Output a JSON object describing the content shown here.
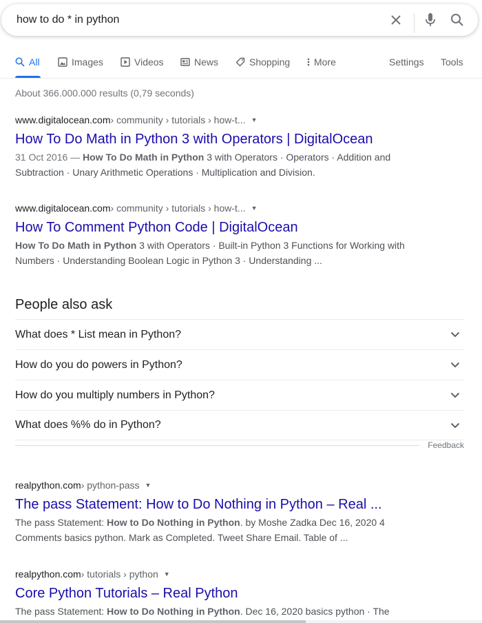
{
  "search": {
    "query": "how to do * in python",
    "clear_icon": "close-icon",
    "voice_icon": "mic-icon",
    "search_icon": "search-icon"
  },
  "tabs": [
    {
      "label": "All",
      "icon": "search-icon",
      "active": true
    },
    {
      "label": "Images",
      "icon": "image-icon"
    },
    {
      "label": "Videos",
      "icon": "play-icon"
    },
    {
      "label": "News",
      "icon": "news-icon"
    },
    {
      "label": "Shopping",
      "icon": "tag-icon"
    },
    {
      "label": "More",
      "icon": "more-vert-icon"
    }
  ],
  "tools": {
    "settings": "Settings",
    "tools": "Tools"
  },
  "stats": "About 366.000.000 results (0,79 seconds)",
  "results_top": [
    {
      "domain": "www.digitalocean.com",
      "path": " › community › tutorials › how-t...",
      "title": "How To Do Math in Python 3 with Operators | DigitalOcean",
      "date": "31 Oct 2016 — ",
      "bold": "How To Do Math in Python",
      "rest1": " 3 with Operators · Operators · Addition and",
      "rest2": "Subtraction · Unary Arithmetic Operations · Multiplication and Division."
    },
    {
      "domain": "www.digitalocean.com",
      "path": " › community › tutorials › how-t...",
      "title": "How To Comment Python Code | DigitalOcean",
      "bold": "How To Do Math in Python",
      "rest1": " 3 with Operators · Built-in Python 3 Functions for Working with",
      "rest2": "Numbers · Understanding Boolean Logic in Python 3 · Understanding ..."
    }
  ],
  "people_also_ask": {
    "title": "People also ask",
    "questions": [
      "What does * List mean in Python?",
      "How do you do powers in Python?",
      "How do you multiply numbers in Python?",
      "What does %% do in Python?"
    ],
    "feedback": "Feedback"
  },
  "results_bottom": [
    {
      "domain": "realpython.com",
      "path": " › python-pass",
      "title": "The pass Statement: How to Do Nothing in Python – Real ...",
      "pre": "The pass Statement: ",
      "bold": "How to Do Nothing in Python",
      "rest1": ". by Moshe Zadka Dec 16, 2020 4",
      "rest2": "Comments basics python. Mark as Completed. Tweet Share Email. Table of ..."
    },
    {
      "domain": "realpython.com",
      "path": " › tutorials › python",
      "title": "Core Python Tutorials – Real Python",
      "pre": "The pass Statement: ",
      "bold": "How to Do Nothing in Python",
      "rest1": ". Dec 16, 2020 basics python · The"
    }
  ],
  "colors": {
    "link": "#1a0dab",
    "accent": "#1a73e8",
    "text": "#202124",
    "muted": "#70757a"
  }
}
